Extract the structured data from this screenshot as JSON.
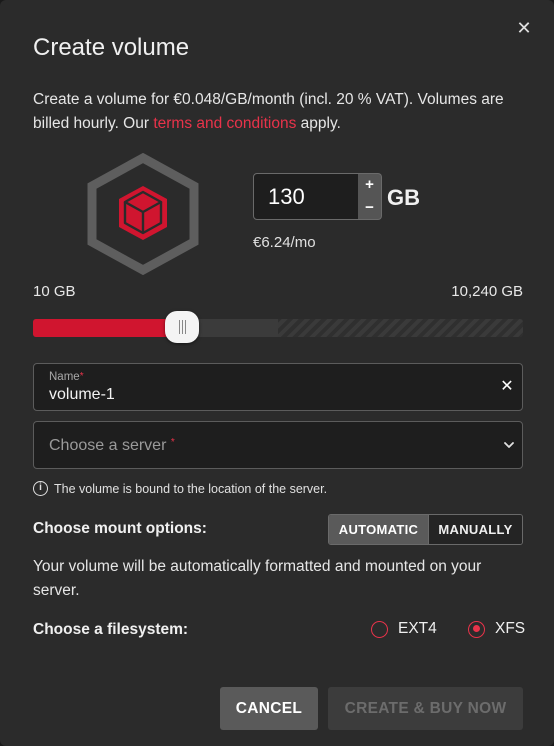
{
  "dialog": {
    "title": "Create volume",
    "close_symbol": "✕",
    "intro_text": "Create a volume for €0.048/GB/month (incl. 20 % VAT). Volumes are billed hourly. Our ",
    "terms_link": "terms and conditions",
    "intro_tail": " apply."
  },
  "size": {
    "value": "130",
    "plus": "+",
    "minus": "−",
    "unit": "GB",
    "monthly_price": "€6.24/mo"
  },
  "slider": {
    "min_label": "10 GB",
    "max_label": "10,240 GB",
    "fill_fraction": 0.305
  },
  "name_field": {
    "label": "Name",
    "required_mark": "*",
    "value": "volume-1",
    "clear_symbol": "✕"
  },
  "server_select": {
    "placeholder": "Choose a server",
    "required_mark": "*"
  },
  "hint": {
    "icon": "info-icon",
    "icon_glyph": "i",
    "text": "The volume is bound to the location of the server."
  },
  "mount": {
    "label": "Choose mount options:",
    "options": [
      "AUTOMATIC",
      "MANUALLY"
    ],
    "selected": "AUTOMATIC",
    "description": "Your volume will be automatically formatted and mounted on your server."
  },
  "filesystem": {
    "label": "Choose a filesystem:",
    "options": [
      "EXT4",
      "XFS"
    ],
    "selected": "XFS"
  },
  "actions": {
    "cancel": "CANCEL",
    "create": "CREATE & BUY NOW"
  },
  "colors": {
    "accent": "#e8334a",
    "slider_fill": "#d0152f",
    "dialog_bg": "#2b2b2b",
    "disabled_text": "#6c6c6c"
  },
  "icons": {
    "volume": "volume-hexagon-cube-icon",
    "close": "close-icon",
    "chevron": "chevron-down-icon"
  }
}
